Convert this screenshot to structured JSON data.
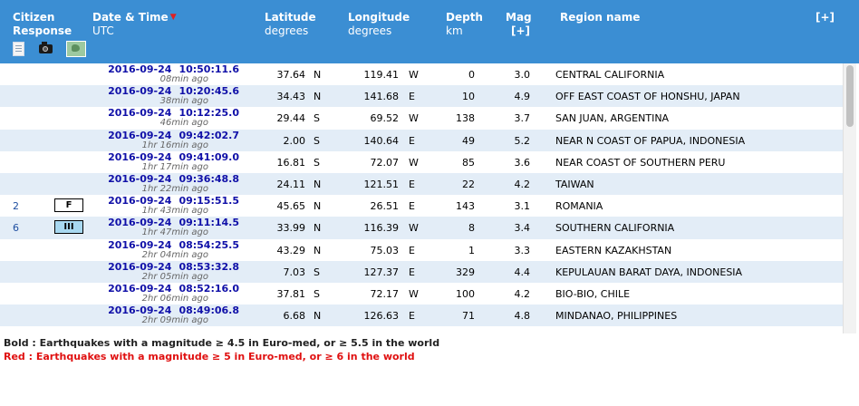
{
  "header": {
    "citizen_label": "Citizen",
    "response_label": "Response",
    "date_time_label": "Date & Time",
    "utc_label": "UTC",
    "latitude_label": "Latitude",
    "latitude_unit": "degrees",
    "longitude_label": "Longitude",
    "longitude_unit": "degrees",
    "depth_label": "Depth",
    "depth_unit": "km",
    "mag_label": "Mag",
    "mag_expand": "[+]",
    "region_label": "Region name",
    "expand_all": "[+]",
    "sort_indicator": "▼",
    "icons": [
      "document-icon",
      "camera-icon",
      "map-icon"
    ]
  },
  "rows": [
    {
      "responses": "",
      "intensity": "",
      "date": "2016-09-24",
      "time": "10:50:11.6",
      "ago": "08min ago",
      "lat": "37.64",
      "lat_dir": "N",
      "lon": "119.41",
      "lon_dir": "W",
      "depth": "0",
      "mag": "3.0",
      "region": "CENTRAL CALIFORNIA"
    },
    {
      "responses": "",
      "intensity": "",
      "date": "2016-09-24",
      "time": "10:20:45.6",
      "ago": "38min ago",
      "lat": "34.43",
      "lat_dir": "N",
      "lon": "141.68",
      "lon_dir": "E",
      "depth": "10",
      "mag": "4.9",
      "region": "OFF EAST COAST OF HONSHU, JAPAN"
    },
    {
      "responses": "",
      "intensity": "",
      "date": "2016-09-24",
      "time": "10:12:25.0",
      "ago": "46min ago",
      "lat": "29.44",
      "lat_dir": "S",
      "lon": "69.52",
      "lon_dir": "W",
      "depth": "138",
      "mag": "3.7",
      "region": "SAN JUAN, ARGENTINA"
    },
    {
      "responses": "",
      "intensity": "",
      "date": "2016-09-24",
      "time": "09:42:02.7",
      "ago": "1hr 16min ago",
      "lat": "2.00",
      "lat_dir": "S",
      "lon": "140.64",
      "lon_dir": "E",
      "depth": "49",
      "mag": "5.2",
      "region": "NEAR N COAST OF PAPUA, INDONESIA"
    },
    {
      "responses": "",
      "intensity": "",
      "date": "2016-09-24",
      "time": "09:41:09.0",
      "ago": "1hr 17min ago",
      "lat": "16.81",
      "lat_dir": "S",
      "lon": "72.07",
      "lon_dir": "W",
      "depth": "85",
      "mag": "3.6",
      "region": "NEAR COAST OF SOUTHERN PERU"
    },
    {
      "responses": "",
      "intensity": "",
      "date": "2016-09-24",
      "time": "09:36:48.8",
      "ago": "1hr 22min ago",
      "lat": "24.11",
      "lat_dir": "N",
      "lon": "121.51",
      "lon_dir": "E",
      "depth": "22",
      "mag": "4.2",
      "region": "TAIWAN"
    },
    {
      "responses": "2",
      "intensity": "F",
      "date": "2016-09-24",
      "time": "09:15:51.5",
      "ago": "1hr 43min ago",
      "lat": "45.65",
      "lat_dir": "N",
      "lon": "26.51",
      "lon_dir": "E",
      "depth": "143",
      "mag": "3.1",
      "region": "ROMANIA"
    },
    {
      "responses": "6",
      "intensity": "III",
      "date": "2016-09-24",
      "time": "09:11:14.5",
      "ago": "1hr 47min ago",
      "lat": "33.99",
      "lat_dir": "N",
      "lon": "116.39",
      "lon_dir": "W",
      "depth": "8",
      "mag": "3.4",
      "region": "SOUTHERN CALIFORNIA"
    },
    {
      "responses": "",
      "intensity": "",
      "date": "2016-09-24",
      "time": "08:54:25.5",
      "ago": "2hr 04min ago",
      "lat": "43.29",
      "lat_dir": "N",
      "lon": "75.03",
      "lon_dir": "E",
      "depth": "1",
      "mag": "3.3",
      "region": "EASTERN KAZAKHSTAN"
    },
    {
      "responses": "",
      "intensity": "",
      "date": "2016-09-24",
      "time": "08:53:32.8",
      "ago": "2hr 05min ago",
      "lat": "7.03",
      "lat_dir": "S",
      "lon": "127.37",
      "lon_dir": "E",
      "depth": "329",
      "mag": "4.4",
      "region": "KEPULAUAN BARAT DAYA, INDONESIA"
    },
    {
      "responses": "",
      "intensity": "",
      "date": "2016-09-24",
      "time": "08:52:16.0",
      "ago": "2hr 06min ago",
      "lat": "37.81",
      "lat_dir": "S",
      "lon": "72.17",
      "lon_dir": "W",
      "depth": "100",
      "mag": "4.2",
      "region": "BIO-BIO, CHILE"
    },
    {
      "responses": "",
      "intensity": "",
      "date": "2016-09-24",
      "time": "08:49:06.8",
      "ago": "2hr 09min ago",
      "lat": "6.68",
      "lat_dir": "N",
      "lon": "126.63",
      "lon_dir": "E",
      "depth": "71",
      "mag": "4.8",
      "region": "MINDANAO, PHILIPPINES"
    }
  ],
  "legend": {
    "bold_text": "Bold : Earthquakes with a magnitude ≥ 4.5 in Euro-med, or ≥ 5.5 in the world",
    "red_text": "Red : Earthquakes with a magnitude ≥ 5 in Euro-med, or ≥ 6 in the world"
  },
  "colors": {
    "header_bg": "#3b8ed3",
    "row_alt_bg": "#e3edf7",
    "date_link": "#1010a8",
    "legend_red": "#e01010",
    "intensity_iii_bg": "#a8d8f0"
  }
}
